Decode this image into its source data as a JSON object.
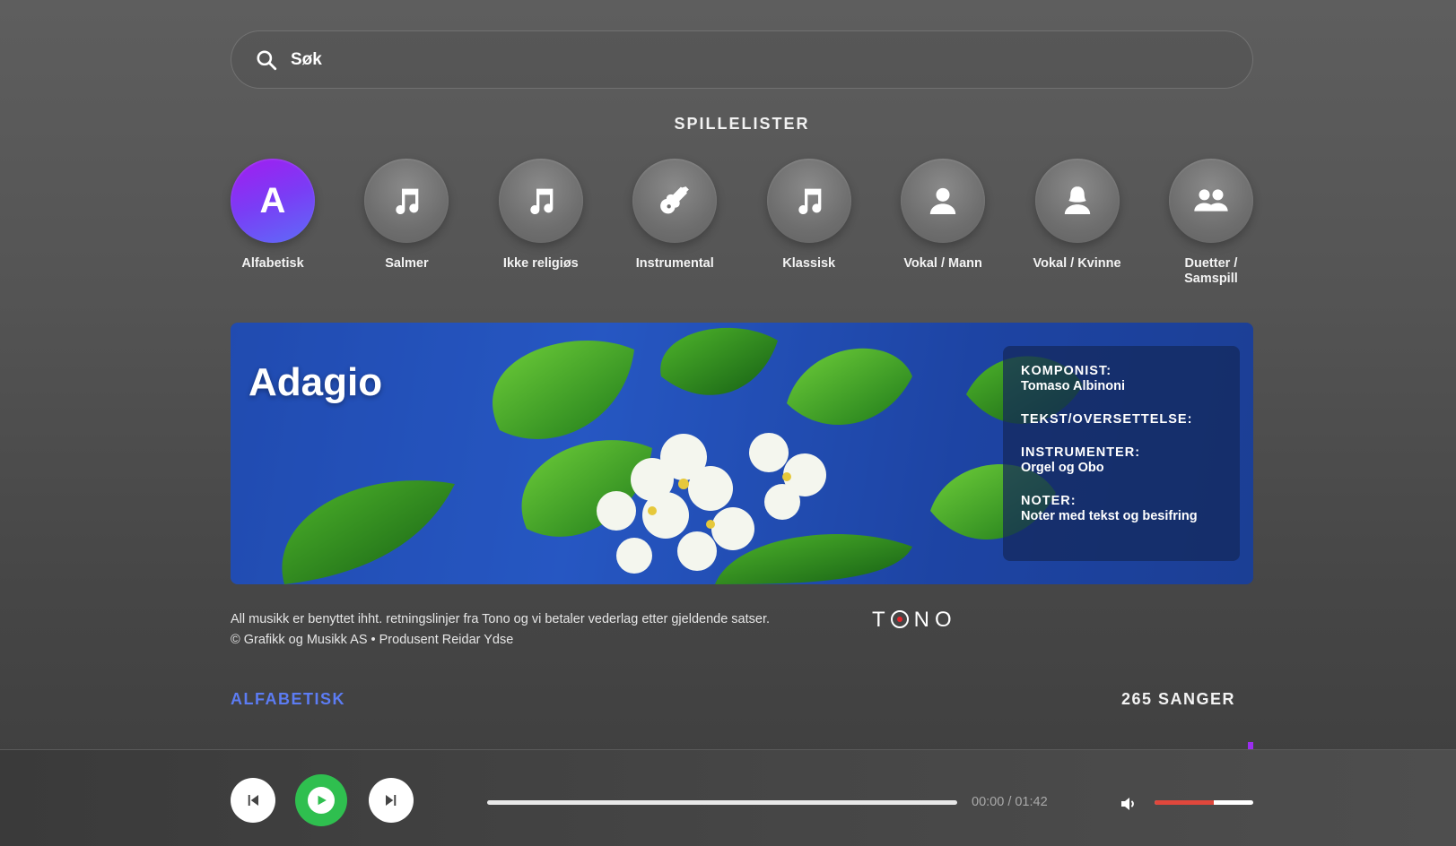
{
  "search": {
    "placeholder": "Søk"
  },
  "playlists_title": "SPILLELISTER",
  "playlists": [
    {
      "label": "Alfabetisk",
      "icon": "letter-a",
      "glyph": "A",
      "active": true
    },
    {
      "label": "Salmer",
      "icon": "music-note-icon"
    },
    {
      "label": "Ikke religiøs",
      "icon": "music-note-icon"
    },
    {
      "label": "Instrumental",
      "icon": "guitar-icon"
    },
    {
      "label": "Klassisk",
      "icon": "music-note-icon"
    },
    {
      "label": "Vokal / Mann",
      "icon": "male-person-icon"
    },
    {
      "label": "Vokal / Kvinne",
      "icon": "female-person-icon"
    },
    {
      "label": "Duetter / Samspill",
      "icon": "group-icon"
    }
  ],
  "song": {
    "title": "Adagio",
    "info": [
      {
        "label": "KOMPONIST:",
        "value": "Tomaso Albinoni"
      },
      {
        "label": "TEKST/OVERSETTELSE:",
        "value": ""
      },
      {
        "label": "INSTRUMENTER:",
        "value": "Orgel og Obo"
      },
      {
        "label": "NOTER:",
        "value": "Noter med tekst og besifring"
      }
    ]
  },
  "legal": {
    "line1": "All musikk er benyttet ihht. retningslinjer fra Tono og vi betaler vederlag etter gjeldende satser.",
    "line2": "© Grafikk og Musikk AS • Produsent Reidar Ydse",
    "logo_t": "T",
    "logo_rest": "NO"
  },
  "list": {
    "sort_label": "ALFABETISK",
    "count_label": "265 SANGER"
  },
  "player": {
    "time": "00:00 / 01:42",
    "progress": 0.0,
    "volume": 0.6,
    "colors": {
      "play": "#2fbf4f",
      "volume": "#e0473c",
      "accent": "#5c7cf3"
    }
  }
}
